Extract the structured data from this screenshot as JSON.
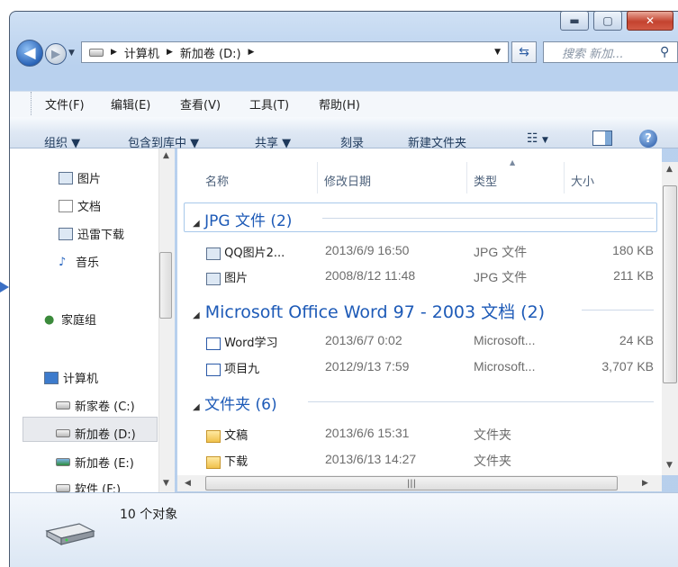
{
  "address": {
    "segments": [
      "计算机",
      "新加卷 (D:)"
    ]
  },
  "search": {
    "placeholder": "搜索 新加..."
  },
  "menu": [
    "文件(F)",
    "编辑(E)",
    "查看(V)",
    "工具(T)",
    "帮助(H)"
  ],
  "toolbar": {
    "organize": "组织 ▼",
    "include": "包含到库中 ▼",
    "share": "共享 ▼",
    "burn": "刻录",
    "new_folder": "新建文件夹"
  },
  "nav": {
    "items": [
      "图片",
      "文档",
      "迅雷下载",
      "音乐",
      "家庭组",
      "计算机",
      "新家卷 (C:)",
      "新加卷 (D:)",
      "新加卷 (E:)",
      "软件 (F:)"
    ]
  },
  "columns": [
    "名称",
    "修改日期",
    "类型",
    "大小"
  ],
  "groups": [
    {
      "title": "JPG 文件 (2)",
      "files": [
        {
          "name": "QQ图片2...",
          "date": "2013/6/9 16:50",
          "type": "JPG 文件",
          "size": "180 KB"
        },
        {
          "name": "图片",
          "date": "2008/8/12 11:48",
          "type": "JPG 文件",
          "size": "211 KB"
        }
      ]
    },
    {
      "title": "Microsoft Office Word 97 - 2003 文档 (2)",
      "files": [
        {
          "name": "Word学习",
          "date": "2013/6/7 0:02",
          "type": "Microsoft...",
          "size": "24 KB"
        },
        {
          "name": "项目九",
          "date": "2012/9/13 7:59",
          "type": "Microsoft...",
          "size": "3,707 KB"
        }
      ]
    },
    {
      "title": "文件夹 (6)",
      "files": [
        {
          "name": "文稿",
          "date": "2013/6/6 15:31",
          "type": "文件夹",
          "size": ""
        },
        {
          "name": "下载",
          "date": "2013/6/13 14:27",
          "type": "文件夹",
          "size": ""
        }
      ]
    }
  ],
  "status": {
    "count": "10 个对象"
  },
  "colors": {
    "group_title": "#1d5ab7",
    "selection": "#e8eaee",
    "accent": "#2a64b8"
  }
}
